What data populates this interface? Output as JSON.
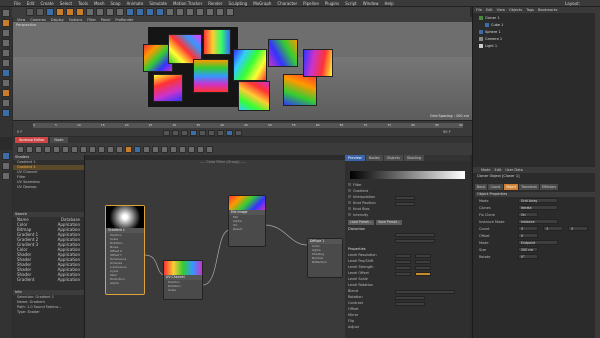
{
  "menubar": {
    "items": [
      "File",
      "Edit",
      "Create",
      "Select",
      "Tools",
      "Mesh",
      "Snap",
      "Animate",
      "Simulate",
      "Motion Tracker",
      "Render",
      "Sculpting",
      "MoGraph",
      "Character",
      "Pipeline",
      "Plugins",
      "Script",
      "Window",
      "Help"
    ],
    "layout_label": "Layout:"
  },
  "viewport": {
    "menu": [
      "View",
      "Cameras",
      "Display",
      "Options",
      "Filter",
      "Panel",
      "ProRender"
    ],
    "label": "Perspective",
    "status": "Grid Spacing : 100 cm"
  },
  "timeline": {
    "ticks": [
      "0",
      "5",
      "10",
      "15",
      "20",
      "25",
      "30",
      "35",
      "40",
      "45",
      "50",
      "55",
      "60",
      "65",
      "70",
      "75",
      "80",
      "85",
      "90"
    ],
    "start": "0 F",
    "end": "90 F"
  },
  "xpresso": {
    "tabs": [
      "Xpresso Editor",
      "Node"
    ],
    "title": "---- Color Filter (Group) ----"
  },
  "nodepanel": {
    "header1": "Shaders",
    "items1": [
      "Gradient 1",
      "Gradient 2",
      "UV Channel",
      "Filter",
      "UV Seamless",
      "UV Dewrap"
    ],
    "header2": "Search",
    "cols": [
      "Name",
      "Database"
    ],
    "items2": [
      "Color",
      "Bitmap",
      "Gradient 1",
      "Gradient 2",
      "Gradient 3",
      "Color",
      "Shader",
      "Shader",
      "Shader",
      "Shader",
      "Shader",
      "Gradient"
    ],
    "db": "Application",
    "header3": "Info",
    "info": [
      "Selection: Gradient 1",
      "Name: Gradient",
      "Path: 1.0 Sound Fabrica...",
      "Type: Shader"
    ]
  },
  "nodes": {
    "gradient": {
      "title": "Gradient 1",
      "ports": [
        "Position",
        "Scale",
        "Rotation",
        "Noise",
        "Offset X",
        "Offset Y",
        "Turbulence",
        "Octaves",
        "Luminance",
        "Cycle",
        "Swirl",
        "Distortion",
        "Alpha"
      ]
    },
    "uv": {
      "title": "UV Channel",
      "ports": [
        "Position",
        "Rotation",
        "Scale"
      ]
    },
    "mix": {
      "title": "Mix Image",
      "ports": [
        "Mix",
        "Alpha",
        "UV",
        "Result"
      ]
    },
    "out": {
      "title": "Diffuse 1",
      "ports": [
        "Color",
        "Alpha",
        "Shading",
        "Normal",
        "Reflection"
      ]
    }
  },
  "preview": {
    "tabs": [
      "Preview",
      "Nodes",
      "Objects",
      "Shading"
    ]
  },
  "attributes": {
    "rows": [
      "Filter",
      "Gradient",
      "Interpolation",
      "Knot Position",
      "Knot Bias",
      "Intensity"
    ],
    "buttons": [
      "Load Preset...",
      "Save Preset..."
    ],
    "section2": "Distortion",
    "section3": "Properties",
    "props": [
      "Level Resolution",
      "Level Pos/Shift",
      "Level Strength",
      "Level Offset",
      "Level Scale",
      "Level Rotation",
      "Blend",
      "Rotation",
      "Contrast",
      "Offset",
      "Mirror",
      "Flip",
      "Adjust"
    ]
  },
  "objmgr": {
    "menu": [
      "File",
      "Edit",
      "View",
      "Objects",
      "Tags",
      "Bookmarks"
    ],
    "objects": [
      "Cloner 1",
      "Cube 1",
      "Sphere 1",
      "Camera 1",
      "Light 1"
    ]
  },
  "attrmgr": {
    "menu": [
      "Mode",
      "Edit",
      "User Data"
    ],
    "title": "Cloner Object [Cloner 1]",
    "tabs": [
      "Basic",
      "Coord.",
      "Object",
      "Transform",
      "Effectors"
    ],
    "section": "Object Properties",
    "rows": [
      "Mode",
      "Clones",
      "Fix Clone",
      "Instance Mode",
      "Count",
      "Offset",
      "Mode",
      "Size",
      "Rotate"
    ],
    "values": [
      "Grid Array",
      "Iterate",
      "On",
      "Instance",
      "3",
      "0",
      "Endpoint",
      "200 cm",
      "0°"
    ]
  },
  "colors": {
    "accent": "#c97c2a",
    "selection": "#d9a23a",
    "active_tab": "#3a62a8"
  }
}
